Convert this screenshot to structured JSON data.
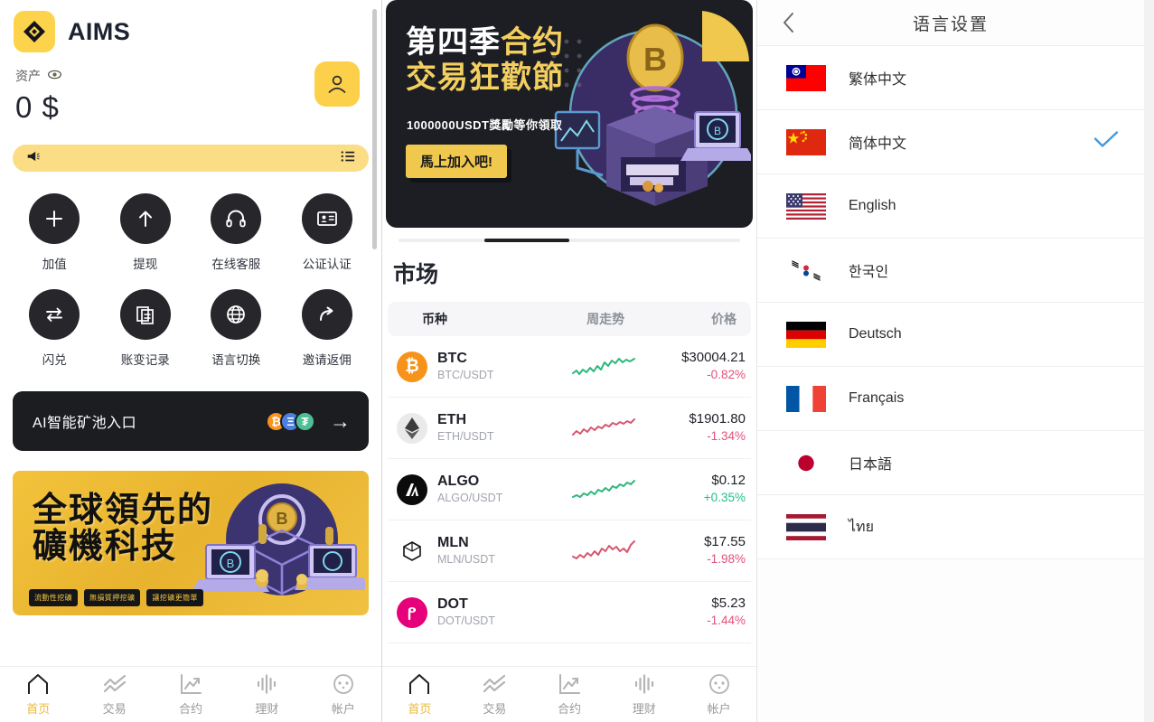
{
  "left_panel": {
    "brand": {
      "name": "AIMS",
      "logo_icon": "diamond-logo-icon"
    },
    "assets": {
      "label": "资产",
      "eye_icon": "eye-icon",
      "balance": "0 $"
    },
    "avatar_icon": "user-avatar-icon",
    "notice": {
      "speaker_icon": "megaphone-icon",
      "text": "",
      "list_icon": "list-icon"
    },
    "quick_actions": [
      {
        "label": "加值",
        "icon": "plus-icon"
      },
      {
        "label": "提现",
        "icon": "arrow-up-icon"
      },
      {
        "label": "在线客服",
        "icon": "headset-icon"
      },
      {
        "label": "公证认证",
        "icon": "id-card-icon"
      },
      {
        "label": "闪兑",
        "icon": "swap-arrows-icon"
      },
      {
        "label": "账变记录",
        "icon": "documents-icon"
      },
      {
        "label": "语言切换",
        "icon": "globe-icon"
      },
      {
        "label": "邀请返佣",
        "icon": "share-arrow-icon"
      }
    ],
    "ai_banner": {
      "text": "AI智能矿池入口",
      "coins": [
        "BTC",
        "ETH",
        "USDT"
      ],
      "coin_glyphs": [
        "₿",
        "Ξ",
        "₮"
      ],
      "arrow_icon": "arrow-right-icon"
    },
    "promo": {
      "line1": "全球領先的",
      "line2": "礦機科技",
      "tags": [
        "流動性挖礦",
        "無損質押挖礦",
        "讓挖礦更簡單"
      ]
    },
    "tabs": [
      {
        "label": "首页",
        "icon": "home-icon",
        "active": true
      },
      {
        "label": "交易",
        "icon": "trade-lines-icon",
        "active": false
      },
      {
        "label": "合约",
        "icon": "chart-arrow-icon",
        "active": false
      },
      {
        "label": "理财",
        "icon": "bars-wave-icon",
        "active": false
      },
      {
        "label": "帐户",
        "icon": "account-face-icon",
        "active": false
      }
    ]
  },
  "mid_panel": {
    "carousel": {
      "title_line1_a": "第四季",
      "title_line1_b": "合约",
      "title_line2": "交易狂歡節",
      "subtitle": "1000000USDT獎勵等你領取",
      "cta": "馬上加入吧!",
      "segments": 4,
      "active_segment": 1
    },
    "market": {
      "title": "市场",
      "columns": {
        "coin": "币种",
        "trend": "周走势",
        "price": "价格"
      },
      "rows": [
        {
          "symbol": "BTC",
          "pair": "BTC/USDT",
          "price": "$30004.21",
          "change": "-0.82%",
          "dir": "down",
          "trend_color": "#2eb87a",
          "icon": "btc-icon",
          "icon_bg": "#f7931a",
          "glyph": "₿"
        },
        {
          "symbol": "ETH",
          "pair": "ETH/USDT",
          "price": "$1901.80",
          "change": "-1.34%",
          "dir": "down",
          "trend_color": "#d6576f",
          "icon": "eth-icon",
          "icon_bg": "#e8e8e8",
          "glyph": "⧫"
        },
        {
          "symbol": "ALGO",
          "pair": "ALGO/USDT",
          "price": "$0.12",
          "change": "+0.35%",
          "dir": "up",
          "trend_color": "#2eb87a",
          "icon": "algo-icon",
          "icon_bg": "#0b0b0b",
          "glyph": "ᐃ"
        },
        {
          "symbol": "MLN",
          "pair": "MLN/USDT",
          "price": "$17.55",
          "change": "-1.98%",
          "dir": "down",
          "trend_color": "#d6576f",
          "icon": "mln-icon",
          "icon_bg": "#ffffff",
          "glyph": "⬡"
        },
        {
          "symbol": "DOT",
          "pair": "DOT/USDT",
          "price": "$5.23",
          "change": "-1.44%",
          "dir": "down",
          "trend_color": "",
          "icon": "dot-icon",
          "icon_bg": "#e6007a",
          "glyph": "Ⓟ"
        }
      ]
    },
    "tabs": [
      {
        "label": "首页",
        "icon": "home-icon",
        "active": true
      },
      {
        "label": "交易",
        "icon": "trade-lines-icon",
        "active": false
      },
      {
        "label": "合约",
        "icon": "chart-arrow-icon",
        "active": false
      },
      {
        "label": "理财",
        "icon": "bars-wave-icon",
        "active": false
      },
      {
        "label": "帐户",
        "icon": "account-face-icon",
        "active": false
      }
    ]
  },
  "right_panel": {
    "header": {
      "title": "语言设置",
      "back_icon": "chevron-left-icon"
    },
    "selected_check_color": "#3b9ae1",
    "languages": [
      {
        "label": "繁体中文",
        "flag": "flag-taiwan",
        "selected": false
      },
      {
        "label": "简体中文",
        "flag": "flag-china",
        "selected": true
      },
      {
        "label": "English",
        "flag": "flag-usa",
        "selected": false
      },
      {
        "label": "한국인",
        "flag": "flag-korea",
        "selected": false
      },
      {
        "label": "Deutsch",
        "flag": "flag-germany",
        "selected": false
      },
      {
        "label": "Français",
        "flag": "flag-france",
        "selected": false
      },
      {
        "label": "日本語",
        "flag": "flag-japan",
        "selected": false
      },
      {
        "label": "ไทย",
        "flag": "flag-thailand",
        "selected": false
      }
    ]
  },
  "theme": {
    "accent_yellow": "#fcd34b",
    "dark": "#26262b",
    "up_green": "#1fbf8f",
    "down_red": "#e2527a"
  }
}
